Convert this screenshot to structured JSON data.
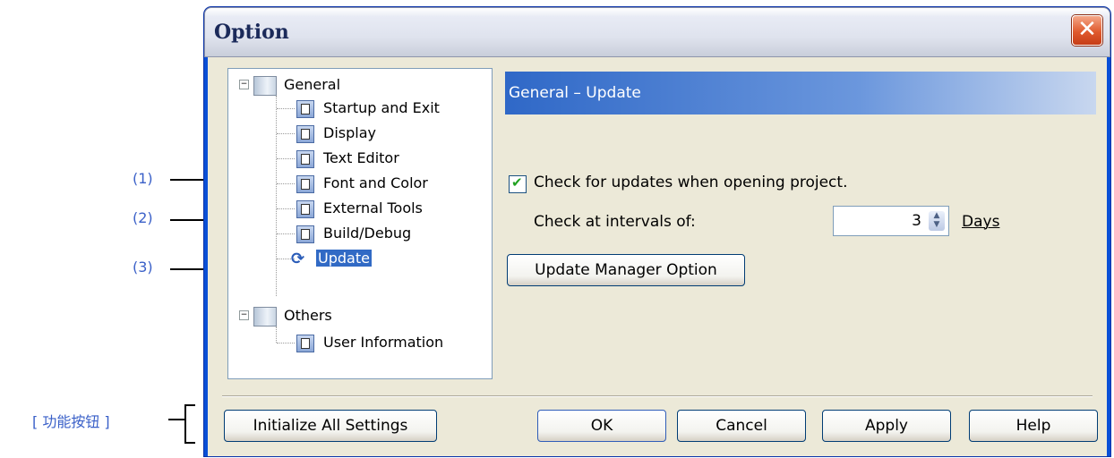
{
  "window": {
    "title": "Option",
    "close_icon": "close-icon"
  },
  "tree": {
    "general": "General",
    "general_items": [
      "Startup and Exit",
      "Display",
      "Text Editor",
      "Font and Color",
      "External Tools",
      "Build/Debug",
      "Update"
    ],
    "selected": "Update",
    "others": "Others",
    "others_items": [
      "User Information"
    ]
  },
  "panel": {
    "header": "General – Update",
    "check_updates_label": "Check for updates when opening project.",
    "check_updates_checked": true,
    "interval_label": "Check at intervals of:",
    "interval_value": "3",
    "interval_unit": "Days",
    "update_manager_button": "Update Manager Option"
  },
  "buttons": {
    "initialize": "Initialize All Settings",
    "ok": "OK",
    "cancel": "Cancel",
    "apply": "Apply",
    "help": "Help"
  },
  "annotations": {
    "one": "(1)",
    "two": "(2)",
    "three": "(3)",
    "func_buttons": "[ 功能按钮 ]"
  },
  "colors": {
    "header_blue": "#2f68c7",
    "callout_blue": "#3a60c8",
    "selection": "#316ac5"
  }
}
